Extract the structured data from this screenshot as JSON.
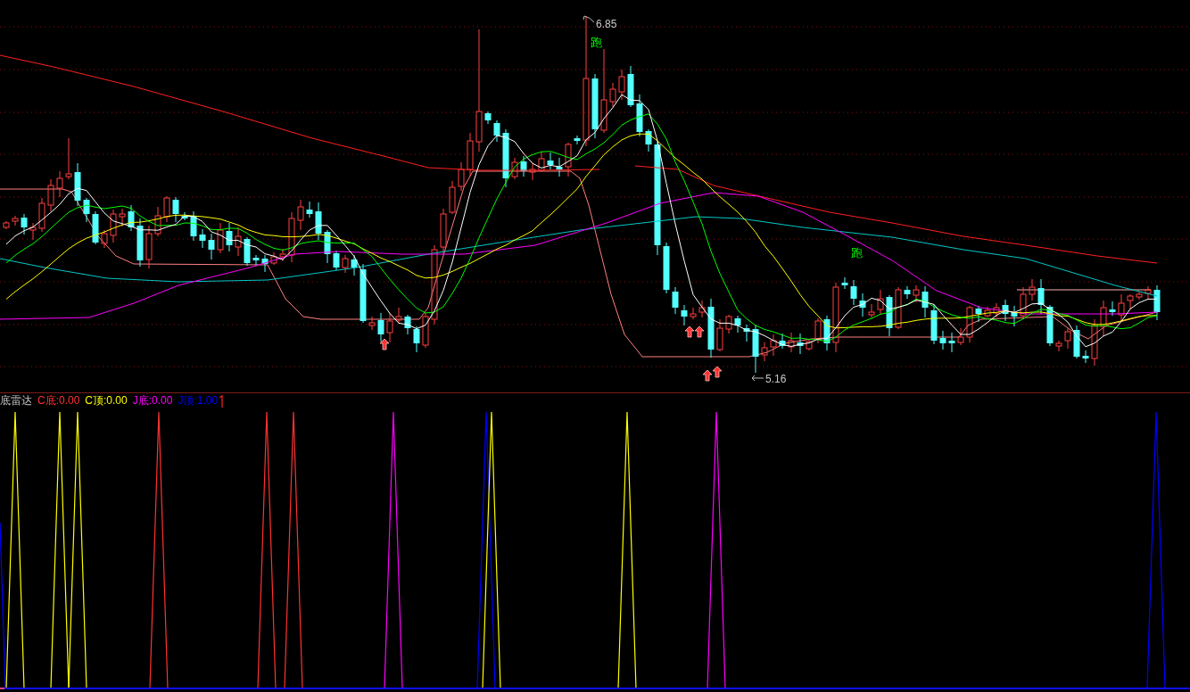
{
  "price_chart": {
    "high_label": "6.85",
    "low_label": "5.16",
    "signal_labels": [
      "跑",
      "跑"
    ]
  },
  "indicator": {
    "title": "底雷达",
    "items": [
      {
        "text": "C底:0.00",
        "color": "#ff3232"
      },
      {
        "text": "C顶:0.00",
        "color": "#ffff00"
      },
      {
        "text": "J底:0.00",
        "color": "#ff00ff"
      },
      {
        "text": "J顶:1.00",
        "color": "#0000ff"
      }
    ]
  }
}
